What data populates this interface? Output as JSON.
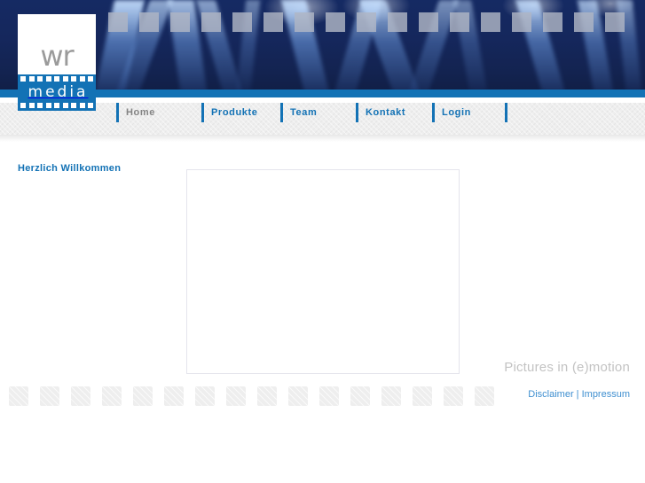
{
  "site": {
    "logo": {
      "word_top": "wr",
      "word_bottom": "media",
      "icon": "film-strip-logo"
    },
    "header_image_alt": "stage-lighting-banner"
  },
  "nav": {
    "items": [
      {
        "label": "Home",
        "current": true
      },
      {
        "label": "Produkte",
        "current": false
      },
      {
        "label": "Team",
        "current": false
      },
      {
        "label": "Kontakt",
        "current": false
      },
      {
        "label": "Login",
        "current": false
      }
    ]
  },
  "main": {
    "heading": "Herzlich Willkommen",
    "content_box_text": ""
  },
  "footer": {
    "tagline": "Pictures in (e)motion",
    "links": [
      {
        "label": "Disclaimer"
      },
      {
        "label": "Impressum"
      }
    ],
    "separator": "|"
  },
  "colors": {
    "brand_blue": "#1372b5",
    "link_blue": "#3f8fd0",
    "header_navy": "#111f49",
    "nav_gray": "#eeeeee",
    "tagline_gray": "#c3c3c3",
    "current_nav_gray": "#848484",
    "box_border": "#e4e4ec"
  }
}
